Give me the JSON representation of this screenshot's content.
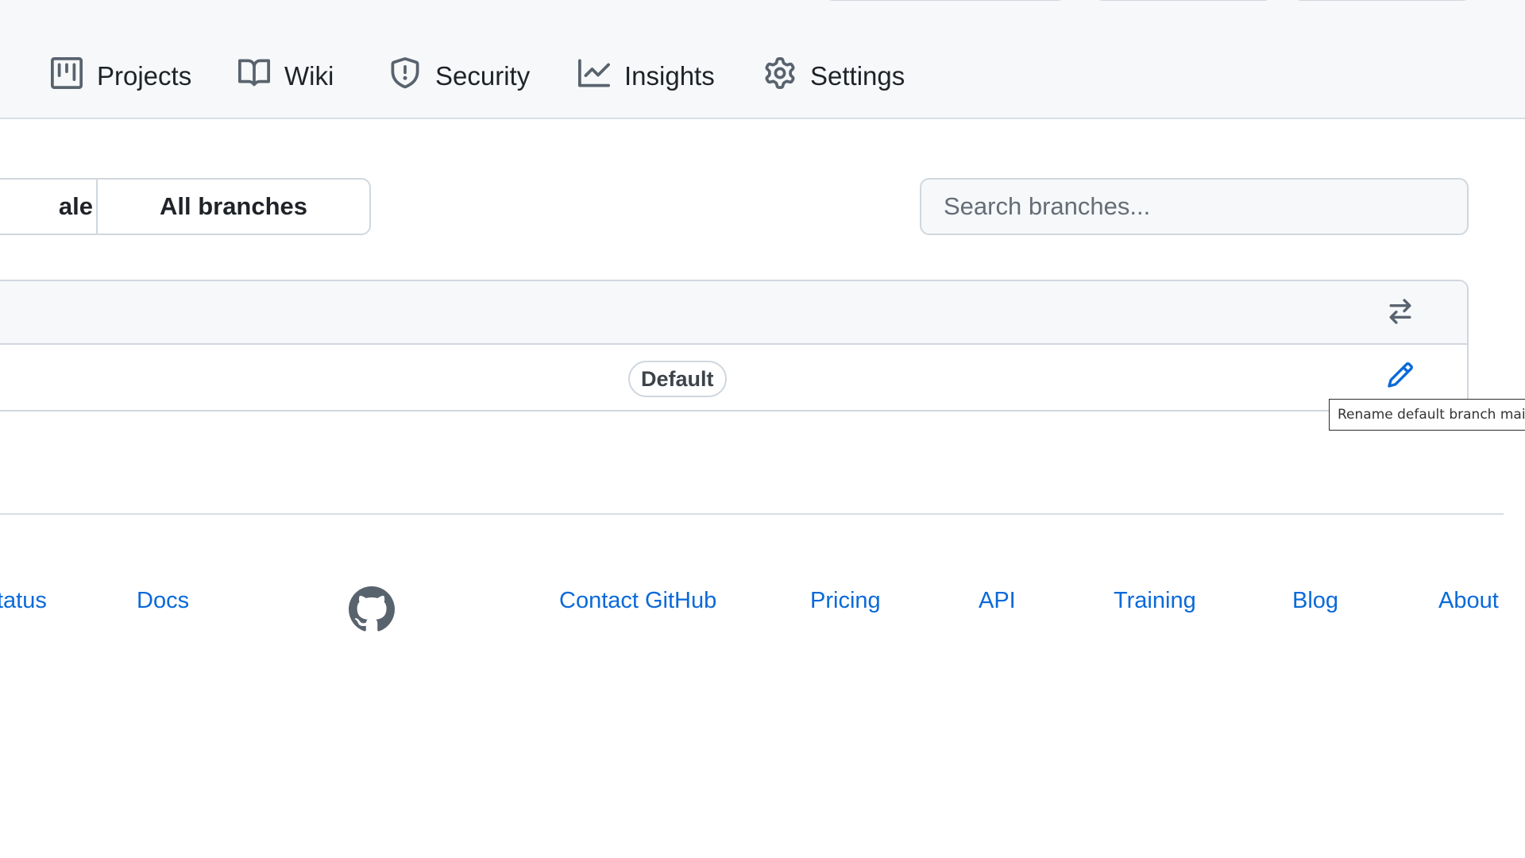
{
  "repo_nav": {
    "items": [
      {
        "label": "Projects",
        "icon": "project-board-icon"
      },
      {
        "label": "Wiki",
        "icon": "book-icon"
      },
      {
        "label": "Security",
        "icon": "shield-icon"
      },
      {
        "label": "Insights",
        "icon": "graph-icon"
      },
      {
        "label": "Settings",
        "icon": "gear-icon"
      }
    ]
  },
  "branch_filters": {
    "tabs": [
      {
        "label": "ale"
      },
      {
        "label": "All branches"
      }
    ],
    "search_placeholder": "Search branches..."
  },
  "branch_table": {
    "header_action_icon": "compare-arrows-icon",
    "rows": [
      {
        "badge": "Default",
        "action_icon": "pencil-icon"
      }
    ]
  },
  "tooltip": {
    "text": "Rename default branch main"
  },
  "footer": {
    "links": [
      {
        "label": "tatus"
      },
      {
        "label": "Docs"
      },
      {
        "label": "Contact GitHub"
      },
      {
        "label": "Pricing"
      },
      {
        "label": "API"
      },
      {
        "label": "Training"
      },
      {
        "label": "Blog"
      },
      {
        "label": "About"
      }
    ],
    "logo_icon": "github-mark-icon"
  },
  "colors": {
    "link": "#0969da",
    "header_bg": "#f6f8fa",
    "border": "#d0d7de",
    "text": "#1f2328",
    "muted": "#656d76"
  }
}
